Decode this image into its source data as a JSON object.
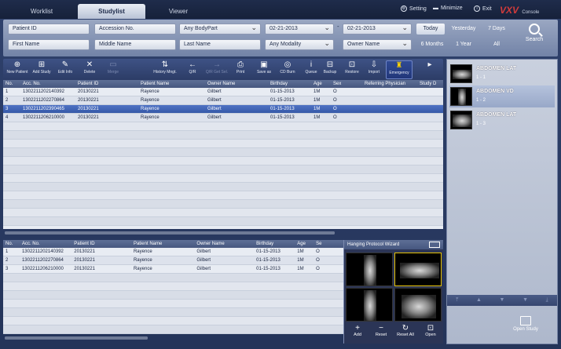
{
  "tabs": [
    {
      "label": "Worklist"
    },
    {
      "label": "Studylist"
    },
    {
      "label": "Viewer"
    }
  ],
  "top_controls": {
    "setting": "Setting",
    "minimize": "Minimize",
    "exit": "Exit"
  },
  "logo": {
    "text": "VXV",
    "sub": "Console"
  },
  "search": {
    "patient_id": "Patient ID",
    "accession": "Accession No.",
    "bodypart": "Any BodyPart",
    "date_from": "02-21-2013",
    "date_to": "02-21-2013",
    "first_name": "First Name",
    "middle_name": "Middle Name",
    "last_name": "Last Name",
    "modality": "Any Modality",
    "owner_name": "Owner Name",
    "date_separator": "-",
    "quick": [
      "Today",
      "Yesterday",
      "7 Days",
      "6 Months",
      "1 Year",
      "All"
    ],
    "search_label": "Search"
  },
  "toolbar": [
    {
      "icon": "new-patient-icon",
      "glyph": "⊕",
      "label": "New Patient",
      "enabled": true
    },
    {
      "icon": "add-study-icon",
      "glyph": "⊞",
      "label": "Add Study",
      "enabled": true
    },
    {
      "icon": "edit-info-icon",
      "glyph": "✎",
      "label": "Edit Info",
      "enabled": true
    },
    {
      "icon": "delete-icon",
      "glyph": "✕",
      "label": "Delete",
      "enabled": true
    },
    {
      "icon": "merge-icon",
      "glyph": "▭",
      "label": "Merge",
      "enabled": false
    },
    {
      "icon": "history-mngt-icon",
      "glyph": "⇅",
      "label": "History Mngt.",
      "enabled": true
    },
    {
      "icon": "qr-icon",
      "glyph": "←",
      "label": "Q/R",
      "enabled": true
    },
    {
      "icon": "qr-get-icon",
      "glyph": "→",
      "label": "Q/R Get Sel.",
      "enabled": false
    },
    {
      "icon": "print-icon",
      "glyph": "⎙",
      "label": "Print",
      "enabled": true
    },
    {
      "icon": "save-as-icon",
      "glyph": "▣",
      "label": "Save as",
      "enabled": true
    },
    {
      "icon": "cd-burn-icon",
      "glyph": "◎",
      "label": "CD Burn",
      "enabled": true
    },
    {
      "icon": "queue-icon",
      "glyph": "i",
      "label": "Queue",
      "enabled": true
    },
    {
      "icon": "backup-icon",
      "glyph": "⊟",
      "label": "Backup",
      "enabled": true
    },
    {
      "icon": "restore-icon",
      "glyph": "⊡",
      "label": "Restore",
      "enabled": true
    },
    {
      "icon": "import-icon",
      "glyph": "⇩",
      "label": "Import",
      "enabled": true
    },
    {
      "icon": "emergency-icon",
      "glyph": "♜",
      "label": "Emergency",
      "enabled": true
    },
    {
      "icon": "more-icon",
      "glyph": "▸",
      "label": "",
      "enabled": true
    }
  ],
  "columns": [
    "No.",
    "Acc. No.",
    "Patient ID",
    "Patient Name",
    "Owner Name",
    "Birthday",
    "Age",
    "Sex",
    "Referring Physician",
    "Study D"
  ],
  "columns2": [
    "No.",
    "Acc. No.",
    "Patient ID",
    "Patient Name",
    "Owner Name",
    "Birthday",
    "Age",
    "Se"
  ],
  "studies": [
    {
      "no": "1",
      "acc": "1302211202140392",
      "pid": "20130221",
      "pname": "Rayence",
      "owner": "Gilbert",
      "birthday": "01-15-2013",
      "age": "1M",
      "sex": "O"
    },
    {
      "no": "2",
      "acc": "1302211202270864",
      "pid": "20130221",
      "pname": "Rayence",
      "owner": "Gilbert",
      "birthday": "01-15-2013",
      "age": "1M",
      "sex": "O"
    },
    {
      "no": "3",
      "acc": "1302211202390465",
      "pid": "20130221",
      "pname": "Rayence",
      "owner": "Gilbert",
      "birthday": "01-15-2013",
      "age": "1M",
      "sex": "O"
    },
    {
      "no": "4",
      "acc": "1302211206210000",
      "pid": "20130221",
      "pname": "Rayence",
      "owner": "Gilbert",
      "birthday": "01-15-2013",
      "age": "1M",
      "sex": "O"
    }
  ],
  "history": [
    {
      "no": "1",
      "acc": "1302211202140392",
      "pid": "20130221",
      "pname": "Rayence",
      "owner": "Gilbert",
      "birthday": "01-15-2013",
      "age": "1M",
      "sex": "O"
    },
    {
      "no": "2",
      "acc": "1302211202270864",
      "pid": "20130221",
      "pname": "Rayence",
      "owner": "Gilbert",
      "birthday": "01-15-2013",
      "age": "1M",
      "sex": "O"
    },
    {
      "no": "3",
      "acc": "1302211206210000",
      "pid": "20130221",
      "pname": "Rayence",
      "owner": "Gilbert",
      "birthday": "01-15-2013",
      "age": "1M",
      "sex": "O"
    }
  ],
  "hanging_protocol": {
    "title": "Hanging Protocol Wizard",
    "buttons": [
      {
        "glyph": "+",
        "label": "Add"
      },
      {
        "glyph": "−",
        "label": "Reset"
      },
      {
        "glyph": "↻",
        "label": "Reset All"
      },
      {
        "glyph": "⊡",
        "label": "Open"
      }
    ]
  },
  "series": [
    {
      "name": "ABDOMEN LAT",
      "index": "1 - 1"
    },
    {
      "name": "ABDOMEN VD",
      "index": "1 - 2"
    },
    {
      "name": "ABDOMEN LAT",
      "index": "1 - 3"
    }
  ],
  "open_study_label": "Open Study"
}
